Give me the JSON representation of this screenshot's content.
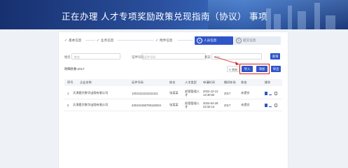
{
  "header": {
    "title": "正在办理 人才专项奖励政策兑现指南（协议） 事项"
  },
  "steps": [
    {
      "label": "基本信息",
      "state": "done"
    },
    {
      "label": "业务信息",
      "state": "done"
    },
    {
      "label": "附件信息",
      "state": "done"
    },
    {
      "num": "4",
      "label": "人员信息",
      "state": "active"
    },
    {
      "num": "5",
      "label": "提交信息",
      "state": "todo"
    }
  ],
  "filters": {
    "name_label": "姓名",
    "name_placeholder": "姓名",
    "id_label": "证件号码",
    "id_placeholder": "证件号码",
    "status_label": "状态",
    "status_placeholder": "状态",
    "search_button": "查询"
  },
  "toolbar": {
    "count_label": "明细条数:2017",
    "refresh_label": "刷新",
    "import_label": "导入",
    "add_label": "添加",
    "export_label": "导出"
  },
  "table": {
    "columns": [
      "序号",
      "企业名称",
      "证件号码",
      "姓名",
      "人才类型",
      "申请时间",
      "期间年份",
      "状态",
      "操作"
    ],
    "rows": [
      [
        "1",
        "天津鹿大数字出版有限公司",
        "120111111111111111",
        "张某某",
        "经营管理人才",
        "2022-12-12 14:30:52",
        "2017",
        "未提交"
      ],
      [
        "2",
        "天津鹿大数字出版有限公司",
        "430104196708126334",
        "张某某",
        "经营管理人才",
        "2024-04-28 23:32:14",
        "2017",
        "未提交"
      ]
    ]
  },
  "colors": {
    "primary": "#2f55c8",
    "highlight": "#e02020",
    "banner": "#17306f"
  },
  "icons": {
    "edit": "edit-icon",
    "view": "view-icon",
    "delete": "trash-icon"
  }
}
